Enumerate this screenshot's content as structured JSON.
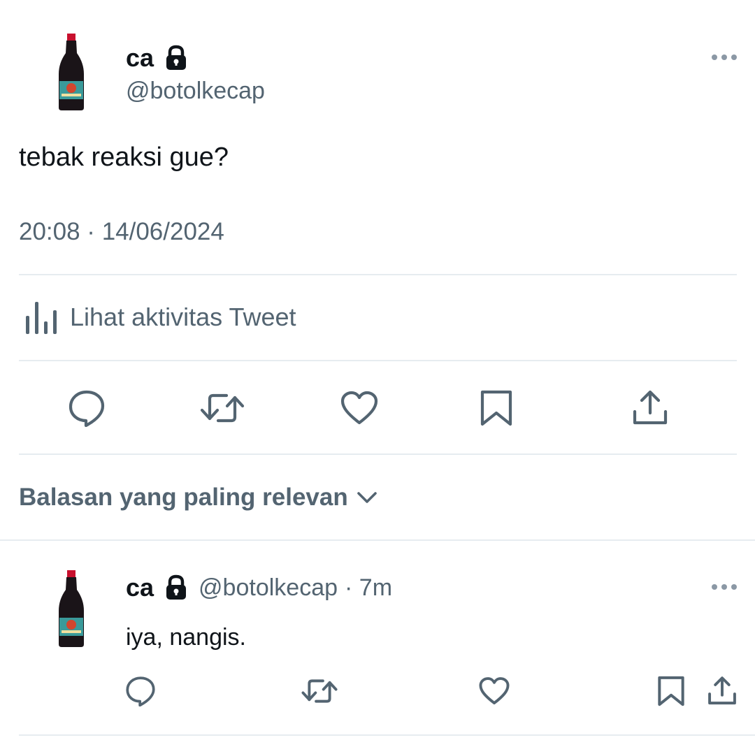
{
  "tweet": {
    "author": {
      "name": "ca",
      "handle": "@botolkecap"
    },
    "text": "tebak reaksi gue?",
    "timestamp": "20:08 · 14/06/2024",
    "activity_label": "Lihat aktivitas Tweet"
  },
  "replies_sort": {
    "label": "Balasan yang paling relevan"
  },
  "reply": {
    "author": {
      "name": "ca",
      "handle": "@botolkecap"
    },
    "time": "· 7m",
    "text": "iya, nangis."
  },
  "icons": {
    "lock": "lock-icon",
    "more": "more-horizontal-icon",
    "reply": "reply-bubble-icon",
    "retweet": "retweet-icon",
    "like": "heart-icon",
    "bookmark": "bookmark-icon",
    "share": "share-icon",
    "analytics": "bar-chart-icon",
    "sort": "chevron-down-icon"
  },
  "colors": {
    "text_primary": "#0f1419",
    "text_secondary": "#536471",
    "divider": "#e6ecf0"
  }
}
